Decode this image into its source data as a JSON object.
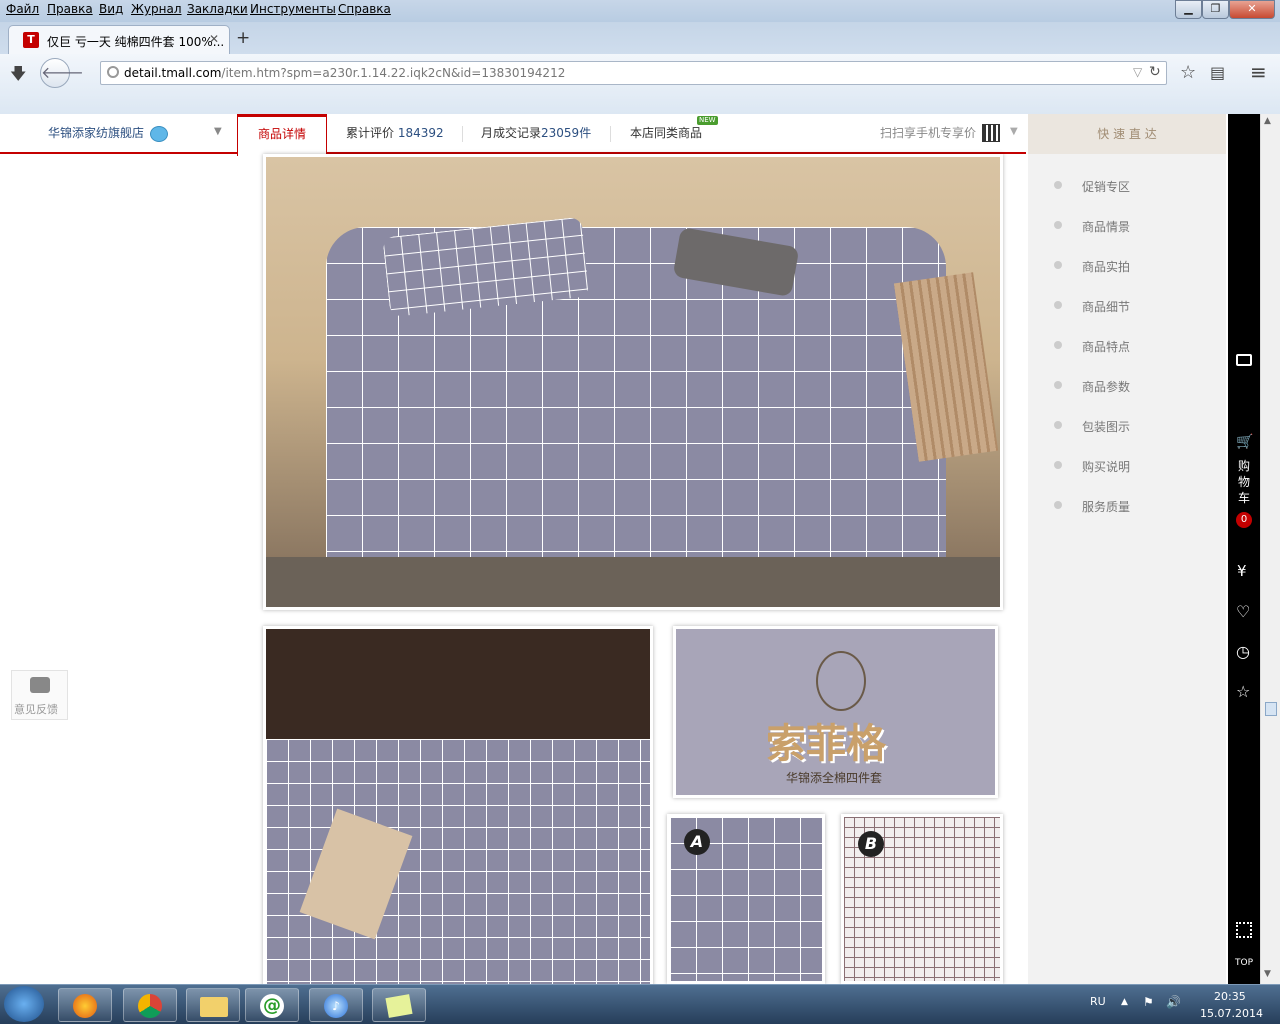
{
  "browser": {
    "menu": [
      "Файл",
      "Правка",
      "Вид",
      "Журнал",
      "Закладки",
      "Инструменты",
      "Справка"
    ],
    "tab_title": "仅巨 亏一天 纯棉四件套 100%...",
    "new_tab": "+",
    "url_domain": "detail.tmall.com",
    "url_rest": "/item.htm?spm=a230r.1.14.22.iqk2cN&id=13830194212"
  },
  "shop": {
    "name": "华锦添家纺旗舰店",
    "tabs": [
      "商品详情",
      "累计评价",
      "月成交记录",
      "本店同类商品"
    ],
    "review_count": "184392",
    "monthly_sales": "23059件",
    "new_badge": "NEW",
    "qr_text": "扫扫享手机专享价",
    "quick_nav_title": "快 速 直 达",
    "quick_nav": [
      "促销专区",
      "商品情景",
      "商品实拍",
      "商品细节",
      "商品特点",
      "商品参数",
      "包装图示",
      "购买说明",
      "服务质量"
    ],
    "feedback": "意见反馈"
  },
  "product": {
    "brand_logo_text": "索菲格",
    "brand_sub": "华锦添全棉四件套",
    "swatch_a": "A",
    "swatch_b": "B",
    "colors": {
      "plaid": "#8b8aa3",
      "bg_purple": "#a8a5b8",
      "accent_red": "#c40000"
    }
  },
  "rightbar": {
    "cart": [
      "购",
      "物",
      "车"
    ],
    "cart_count": "0",
    "top": "TOP"
  },
  "taskbar": {
    "lang": "RU",
    "time": "20:35",
    "date": "15.07.2014"
  }
}
